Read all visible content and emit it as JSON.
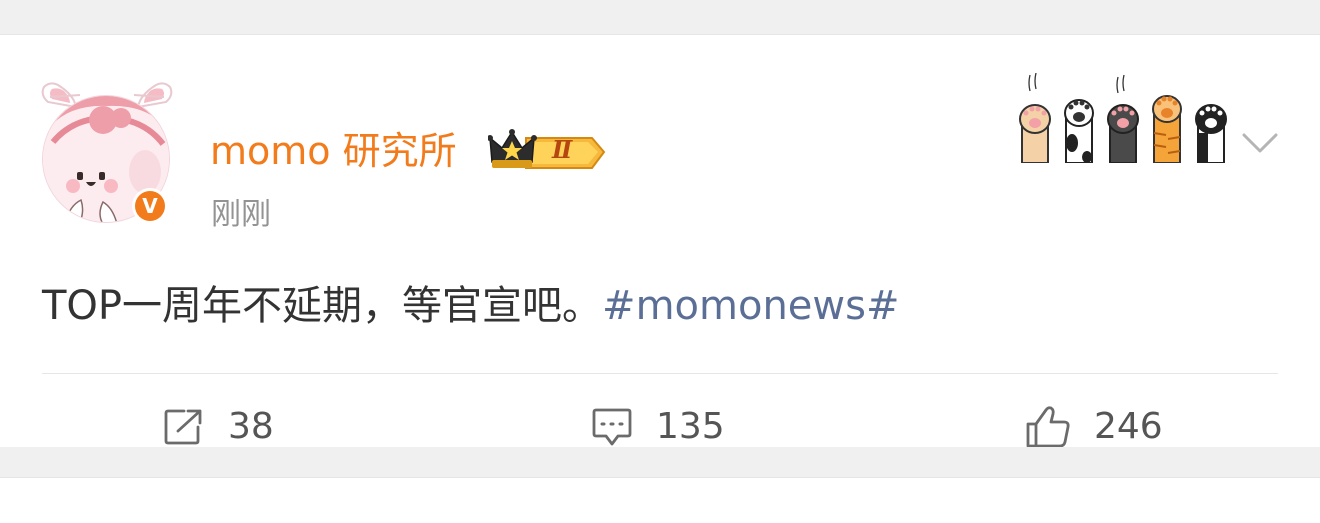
{
  "post": {
    "author": {
      "name": "momo 研究所",
      "vip_level": "Ⅱ",
      "verified_mark": "V",
      "avatar": "bunny-avatar-icon"
    },
    "timestamp": "刚刚",
    "text": "TOP一周年不延期，等官宣吧。",
    "hashtag": "#momonews#",
    "decoration": "cat-paws-icon",
    "menu_icon": "chevron-down-icon"
  },
  "actions": {
    "repost": {
      "icon": "repost-icon",
      "count": "38"
    },
    "comment": {
      "icon": "comment-icon",
      "count": "135"
    },
    "like": {
      "icon": "thumbs-up-icon",
      "count": "246"
    }
  },
  "colors": {
    "username": "#f27b1b",
    "hashtag": "#5b6f96",
    "text": "#333333",
    "meta": "#939393",
    "background": "#f0f0f0"
  }
}
